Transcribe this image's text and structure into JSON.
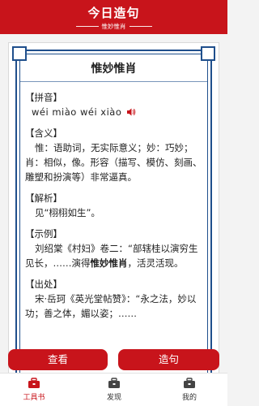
{
  "header": {
    "title": "今日造句",
    "subtitle": "惟妙惟肖"
  },
  "card": {
    "phrase": "惟妙惟肖",
    "pinyin_label": "【拼音】",
    "pinyin": "wéi miào wéi xiào",
    "meaning_label": "【含义】",
    "meaning": "惟：语助词，无实际意义；妙：巧妙；肖：相似，像。形容（描写、模仿、刻画、雕塑和扮演等）非常逼真。",
    "analysis_label": "【解析】",
    "analysis": "见“栩栩如生”。",
    "example_label": "【示例】",
    "example_before": "刘绍棠《村妇》卷二：“部辖桂以演穷生见长，……演得",
    "example_bold": "惟妙惟肖",
    "example_after": "，活灵活现。",
    "source_label": "【出处】",
    "source": "宋·岳珂《英光堂帖赞》：“永之法，妙以功；善之体，媚以姿；……"
  },
  "buttons": {
    "view": "查看",
    "make": "造句"
  },
  "nav": {
    "tab1": "工具书",
    "tab2": "发现",
    "tab3": "我的"
  },
  "colors": {
    "accent": "#c8141b",
    "frame": "#1f4f8c"
  }
}
